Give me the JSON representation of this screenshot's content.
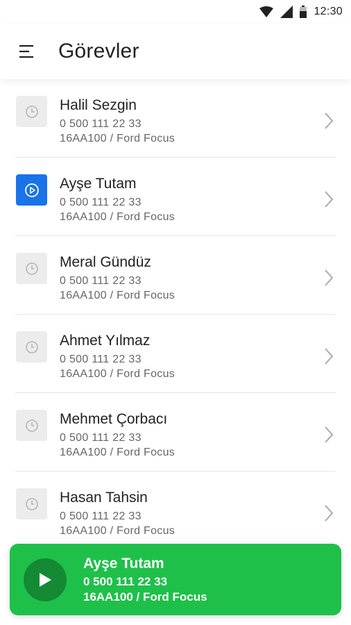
{
  "status_bar": {
    "time": "12:30"
  },
  "app_bar": {
    "title": "Görevler"
  },
  "tasks": [
    {
      "name": "Halil Sezgin",
      "phone": "0 500 111 22 33",
      "car": "16AA100 / Ford Focus",
      "status": "pending"
    },
    {
      "name": "Ayşe Tutam",
      "phone": "0 500 111 22 33",
      "car": "16AA100 / Ford Focus",
      "status": "active"
    },
    {
      "name": "Meral Gündüz",
      "phone": "0 500 111 22 33",
      "car": "16AA100 / Ford Focus",
      "status": "pending"
    },
    {
      "name": "Ahmet Yılmaz",
      "phone": "0 500 111 22 33",
      "car": "16AA100 / Ford Focus",
      "status": "pending"
    },
    {
      "name": "Mehmet Çorbacı",
      "phone": "0 500 111 22 33",
      "car": "16AA100 / Ford Focus",
      "status": "pending"
    },
    {
      "name": "Hasan Tahsin",
      "phone": "0 500 111 22 33",
      "car": "16AA100 / Ford Focus",
      "status": "pending"
    }
  ],
  "player": {
    "name": "Ayşe Tutam",
    "phone": "0 500 111 22 33",
    "car": "16AA100 / Ford Focus"
  },
  "colors": {
    "active_blue": "#1a73e8",
    "player_green": "#1ec04a",
    "play_button": "#138a33"
  },
  "icons": {
    "menu": "menu-icon",
    "pending": "clock-icon",
    "active": "play-circle-icon",
    "chevron": "chevron-right-icon",
    "play": "play-icon"
  }
}
